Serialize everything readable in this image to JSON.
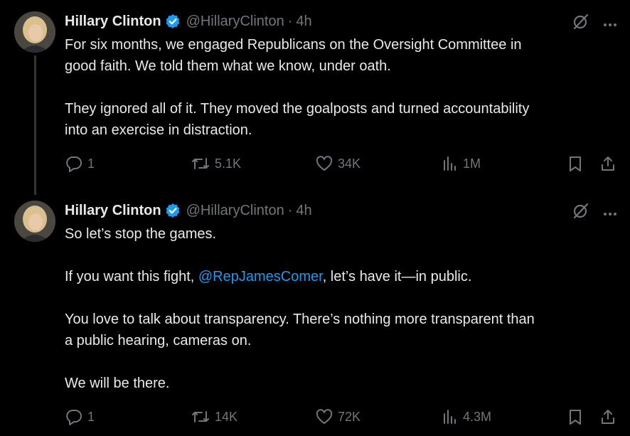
{
  "tweets": [
    {
      "author": "Hillary Clinton",
      "handle": "@HillaryClinton",
      "separator": "·",
      "time": "4h",
      "paragraphs": [
        "For six months, we engaged Republicans on the Oversight Committee in",
        "good faith. We told them what we know, under oath.",
        "",
        "They ignored all of it. They moved the goalposts and turned accountability",
        "into an exercise in distraction."
      ],
      "stats": {
        "replies": "1",
        "reposts": "5.1K",
        "likes": "34K",
        "views": "1M"
      }
    },
    {
      "author": "Hillary Clinton",
      "handle": "@HillaryClinton",
      "separator": "·",
      "time": "4h",
      "line1": "So let’s stop the games.",
      "line2_before": "If you want this fight, ",
      "line2_mention": "@RepJamesComer",
      "line2_after": ", let’s have it—in public.",
      "line3": "You love to talk about transparency. There’s nothing more transparent than",
      "line4": "a public hearing, cameras on.",
      "line5": "We will be there.",
      "stats": {
        "replies": "1",
        "reposts": "14K",
        "likes": "72K",
        "views": "4.3M"
      }
    }
  ],
  "colors": {
    "accent": "#1d9bf0",
    "muted": "#71767b",
    "text": "#e7e9ea",
    "background": "#000000"
  },
  "icons": [
    "verified-badge-icon",
    "grok-icon",
    "more-icon",
    "reply-icon",
    "repost-icon",
    "like-icon",
    "views-icon",
    "bookmark-icon",
    "share-icon"
  ]
}
